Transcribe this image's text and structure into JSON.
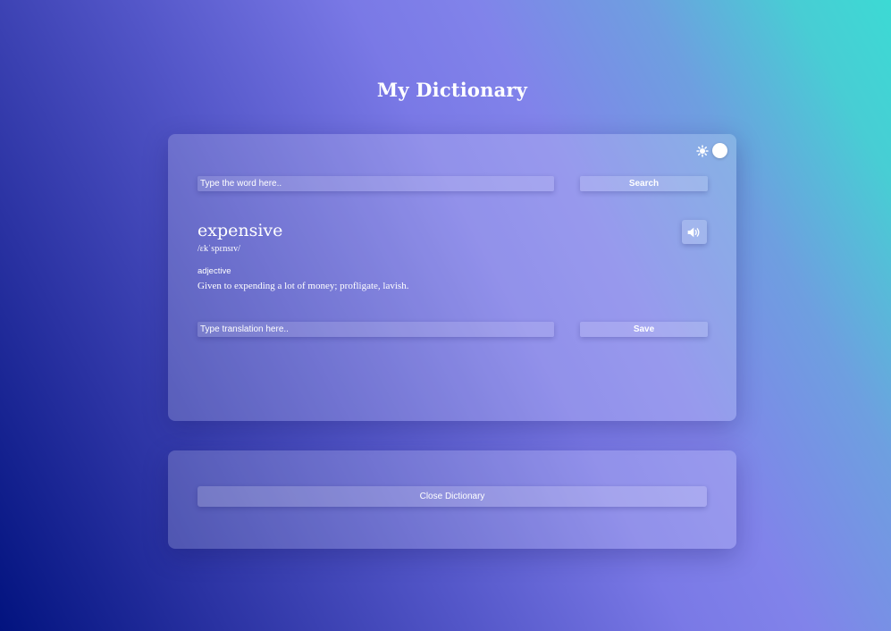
{
  "app": {
    "title": "My Dictionary"
  },
  "theme": {
    "icon": "sun-icon",
    "mode": "light"
  },
  "search": {
    "placeholder": "Type the word here..",
    "value": "",
    "button_label": "Search"
  },
  "entry": {
    "word": "expensive",
    "phonetic": "/ɛkˈspɛnsɪv/",
    "part_of_speech": "adjective",
    "definition": "Given to expending a lot of money; profligate, lavish.",
    "audio_icon": "speaker-icon"
  },
  "translation": {
    "placeholder": "Type translation here..",
    "value": "",
    "button_label": "Save"
  },
  "footer": {
    "close_label": "Close Dictionary"
  },
  "colors": {
    "background_start": "#02137f",
    "background_mid": "#8183ea",
    "background_end": "#3cdad4",
    "text": "#ffffff"
  }
}
